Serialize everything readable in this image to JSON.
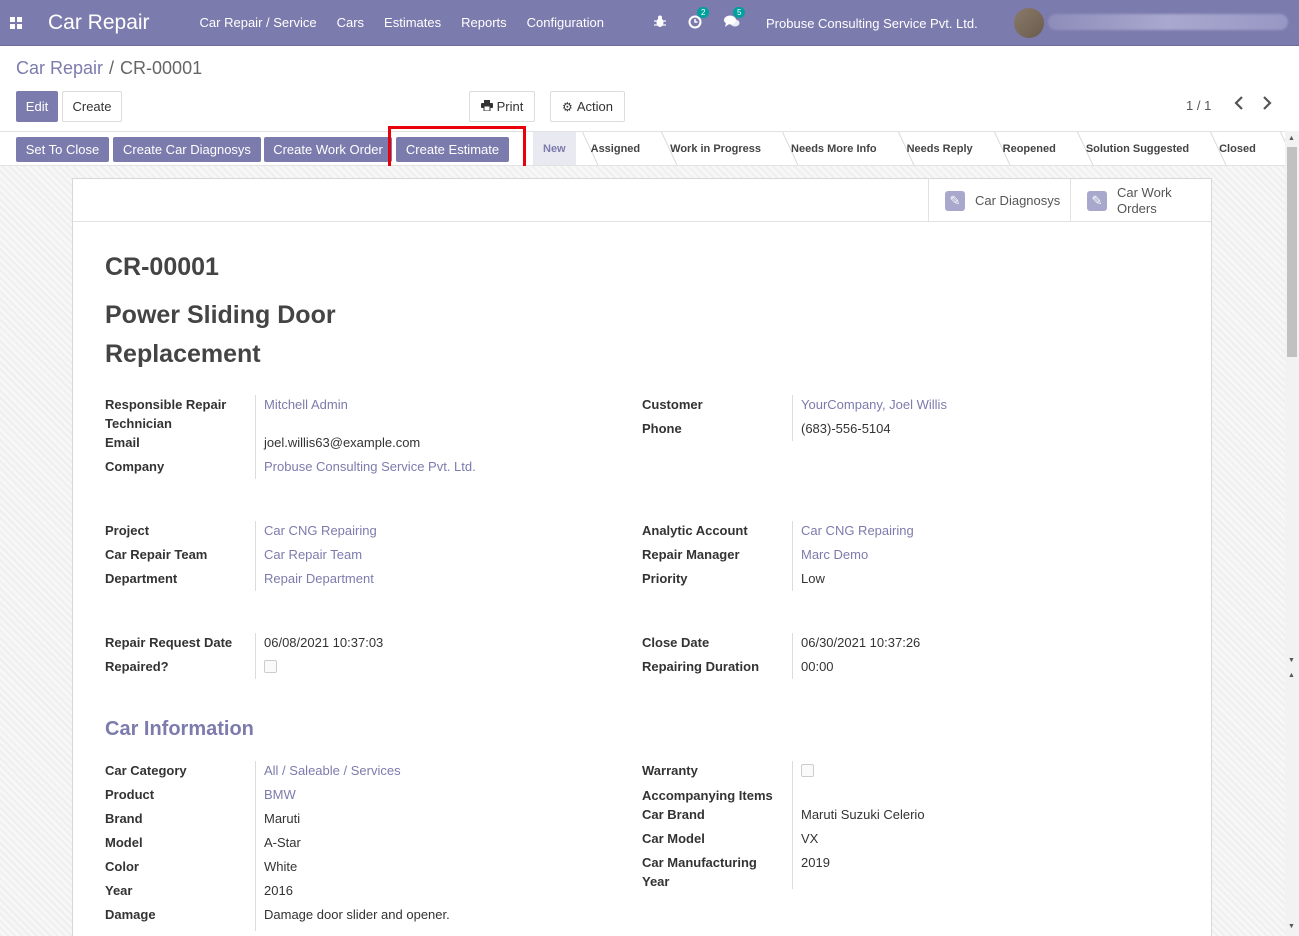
{
  "navbar": {
    "brand": "Car Repair",
    "menu": [
      "Car Repair / Service",
      "Cars",
      "Estimates",
      "Reports",
      "Configuration"
    ],
    "activity_badge": "2",
    "messages_badge": "5",
    "company": "Probuse Consulting Service Pvt. Ltd."
  },
  "breadcrumb": {
    "parent": "Car Repair",
    "separator": "/",
    "current": "CR-00001"
  },
  "buttons": {
    "edit": "Edit",
    "create": "Create",
    "print": "Print",
    "action": "Action"
  },
  "pager": {
    "value": "1 / 1"
  },
  "statusbar": {
    "buttons": [
      "Set To Close",
      "Create Car Diagnosys",
      "Create Work Order",
      "Create Estimate"
    ],
    "stages": [
      "New",
      "Assigned",
      "Work in Progress",
      "Needs More Info",
      "Needs Reply",
      "Reopened",
      "Solution Suggested",
      "Closed"
    ],
    "active_stage": "New"
  },
  "smart_buttons": {
    "diagnosys": "Car Diagnosys",
    "work_orders_line1": "Car Work",
    "work_orders_line2": "Orders"
  },
  "record": {
    "id": "CR-00001",
    "name": "Power Sliding Door Replacement"
  },
  "labels": {
    "technician": "Responsible Repair Technician",
    "email": "Email",
    "company": "Company",
    "customer": "Customer",
    "phone": "Phone",
    "project": "Project",
    "team": "Car Repair Team",
    "department": "Department",
    "analytic": "Analytic Account",
    "manager": "Repair Manager",
    "priority": "Priority",
    "request_date": "Repair Request Date",
    "repaired": "Repaired?",
    "close_date": "Close Date",
    "duration": "Repairing Duration",
    "car_category": "Car Category",
    "product": "Product",
    "brand": "Brand",
    "model": "Model",
    "color": "Color",
    "year": "Year",
    "damage": "Damage",
    "warranty": "Warranty",
    "accompanying": "Accompanying Items",
    "car_brand": "Car Brand",
    "car_model": "Car Model",
    "manufacturing_year": "Car Manufacturing Year"
  },
  "values": {
    "technician": "Mitchell Admin",
    "email": "joel.willis63@example.com",
    "company": "Probuse Consulting Service Pvt. Ltd.",
    "customer": "YourCompany, Joel Willis",
    "phone": "(683)-556-5104",
    "project": "Car CNG Repairing",
    "team": "Car Repair Team",
    "department": "Repair Department",
    "analytic": "Car CNG Repairing",
    "manager": "Marc Demo",
    "priority": "Low",
    "request_date": "06/08/2021 10:37:03",
    "close_date": "06/30/2021 10:37:26",
    "duration": "00:00",
    "car_category": "All / Saleable / Services",
    "product": "BMW",
    "brand": "Maruti",
    "model": "A-Star",
    "color": "White",
    "year": "2016",
    "damage": "Damage door slider and opener.",
    "car_brand": "Maruti Suzuki Celerio",
    "car_model": "VX",
    "manufacturing_year": "2019"
  },
  "section_car_info": "Car Information",
  "icons": {
    "apps": "apps-grid-icon",
    "bug": "bug-icon",
    "activity": "clock-icon",
    "messages": "chat-icon",
    "print": "printer-icon",
    "action": "gear-icon",
    "prev": "chevron-left-icon",
    "next": "chevron-right-icon",
    "smart": "pencil-icon"
  },
  "colors": {
    "brand": "#7c7bad",
    "highlight": "#e8000b",
    "badge": "#00a09d"
  }
}
